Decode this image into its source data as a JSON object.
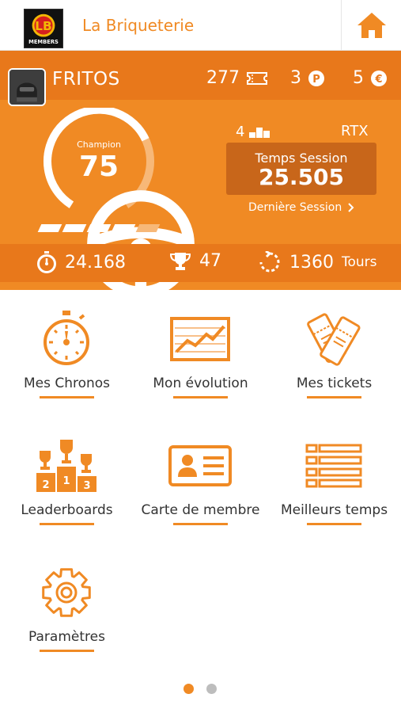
{
  "header": {
    "title": "La Briqueterie",
    "logo_text": "MEMBERS",
    "home_icon": "home-icon"
  },
  "profile": {
    "username": "FRITOS",
    "tickets": "277",
    "points": "3",
    "credits": "5",
    "level_label": "Champion",
    "level_value": "75",
    "level_progress_fraction": 0.72,
    "level_bars_filled": 4,
    "level_bars_total": 5,
    "podiums": "4",
    "category": "RTX",
    "session_label": "Temps Session",
    "session_value": "25.505",
    "last_session_link": "Dernière Session",
    "best_time": "24.168",
    "trophies": "47",
    "laps": "1360",
    "laps_unit": "Tours"
  },
  "menu": [
    {
      "label": "Mes Chronos",
      "icon": "stopwatch-icon"
    },
    {
      "label": "Mon évolution",
      "icon": "chart-icon"
    },
    {
      "label": "Mes tickets",
      "icon": "tickets-icon"
    },
    {
      "label": "Leaderboards",
      "icon": "trophies-podium-icon"
    },
    {
      "label": "Carte de membre",
      "icon": "member-card-icon"
    },
    {
      "label": "Meilleurs temps",
      "icon": "list-icon"
    },
    {
      "label": "Paramètres",
      "icon": "gear-icon"
    }
  ],
  "pager": {
    "pages": 2,
    "active": 1
  },
  "colors": {
    "accent": "#f08a24",
    "accent_dark": "#e8781b",
    "box_dark": "#c8661a"
  }
}
